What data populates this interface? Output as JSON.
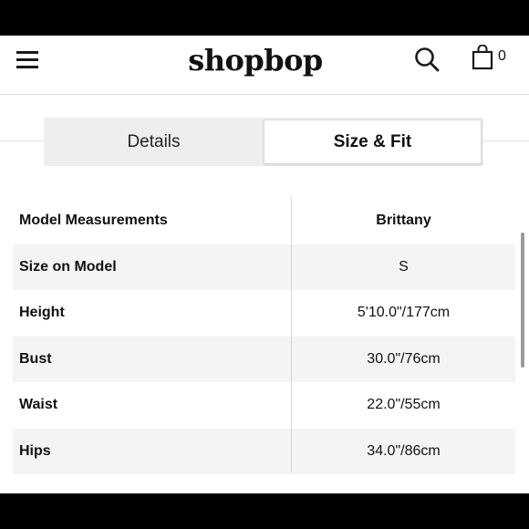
{
  "header": {
    "logo": "shopbop",
    "bag_count": "0",
    "icons": [
      "menu-icon",
      "search-icon",
      "shopping-bag-icon"
    ]
  },
  "tabs": [
    {
      "label": "Details",
      "active": false
    },
    {
      "label": "Size & Fit",
      "active": true
    }
  ],
  "measurements": {
    "header": {
      "label": "Model Measurements",
      "value": "Brittany"
    },
    "rows": [
      {
        "label": "Size on Model",
        "value": "S"
      },
      {
        "label": "Height",
        "value": "5'10.0\"/177cm"
      },
      {
        "label": "Bust",
        "value": "30.0\"/76cm"
      },
      {
        "label": "Waist",
        "value": "22.0\"/55cm"
      },
      {
        "label": "Hips",
        "value": "34.0\"/86cm"
      }
    ]
  },
  "colors": {
    "tab_bar_bg": "#efeeec",
    "row_shade": "#f4f4f4",
    "text": "#111111"
  }
}
